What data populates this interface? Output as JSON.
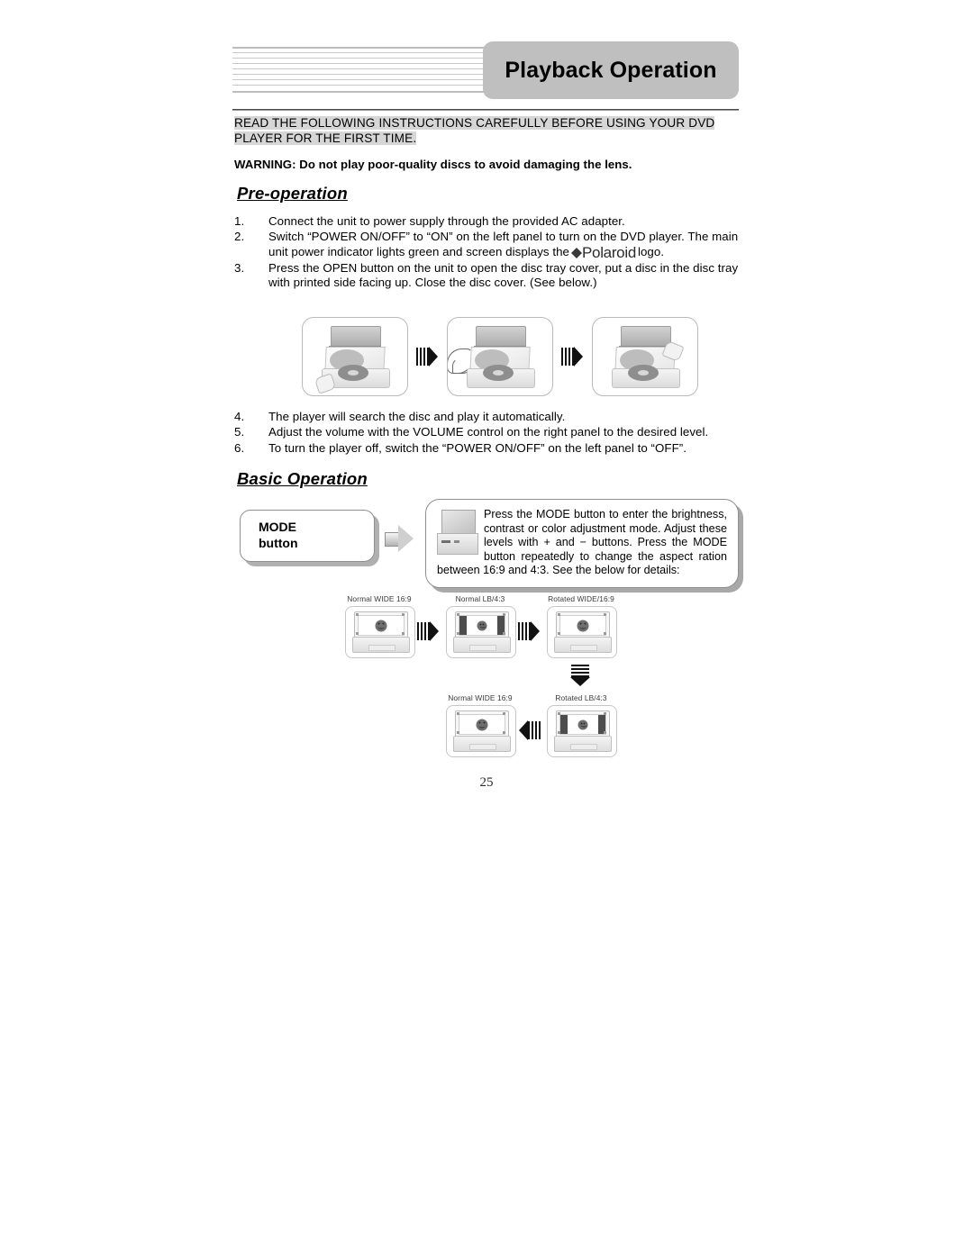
{
  "header": {
    "title": "Playback Operation",
    "decor_lines": 9
  },
  "intro": {
    "line1": "READ THE FOLLOWING INSTRUCTIONS CAREFULLY BEFORE USING YOUR DVD",
    "line2": "PLAYER FOR THE FIRST TIME."
  },
  "warning": {
    "text": "WARNING: Do not play poor-quality discs to avoid damaging the lens."
  },
  "sections": {
    "pre_operation_heading": "Pre-operation",
    "basic_operation_heading": "Basic Operation"
  },
  "pre_operation_steps": [
    {
      "num": "1.",
      "text": "Connect the unit to power supply through the provided AC adapter."
    },
    {
      "num": "2.",
      "text_before": "Switch “POWER ON/OFF” to “ON” on the left panel to turn on the DVD player. The main unit power indicator lights green and screen displays the",
      "logo_word": "Polaroid",
      "text_after": "logo."
    },
    {
      "num": "3.",
      "text": "Press the OPEN button on the unit to open the disc tray cover, put a disc in the disc tray with printed side facing up. Close the disc cover. (See below.)"
    }
  ],
  "post_operation_steps": [
    {
      "num": "4.",
      "text": "The player will search the disc and play it automatically."
    },
    {
      "num": "5.",
      "text": "Adjust the volume with the VOLUME control on the right panel to the desired level."
    },
    {
      "num": "6.",
      "text": "To turn the player off, switch the “POWER ON/OFF” on the left panel to “OFF”."
    }
  ],
  "tray_illustration": {
    "panels": [
      "dvd-player-open-with-disc",
      "dvd-player-inserting-disc",
      "dvd-player-closing-cover"
    ],
    "separator": "striped-right-arrow"
  },
  "mode_callout": {
    "button_label_line1": "MODE",
    "button_label_line2": "button",
    "arrow": "gray-right-arrow",
    "thumbnail": "dvd-player-thumbnail",
    "description": "Press the MODE button to enter the brightness, contrast or color adjustment mode. Adjust these levels with + and − buttons. Press the MODE button repeatedly to change the aspect ration between 16:9 and 4:3. See the below for details:"
  },
  "aspect_diagram": {
    "row1": [
      {
        "label": "Normal WIDE 16:9",
        "mode": "wide"
      },
      {
        "label": "Normal LB/4:3",
        "mode": "pillarbox"
      },
      {
        "label": "Rotated WIDE/16:9",
        "mode": "wide"
      }
    ],
    "row2": [
      {
        "label": "Normal WIDE 16:9",
        "mode": "wide"
      },
      {
        "label": "Rotated LB/4:3",
        "mode": "pillarbox"
      }
    ],
    "separators": {
      "right": "striped-right-arrow",
      "down": "striped-down-arrow",
      "left": "striped-left-arrow"
    }
  },
  "footer": {
    "page_number": "25"
  },
  "colors": {
    "header_box": "#bfbfbf",
    "highlight": "#d6d6d6",
    "text": "#000000",
    "rule": "#4a4a4a"
  }
}
